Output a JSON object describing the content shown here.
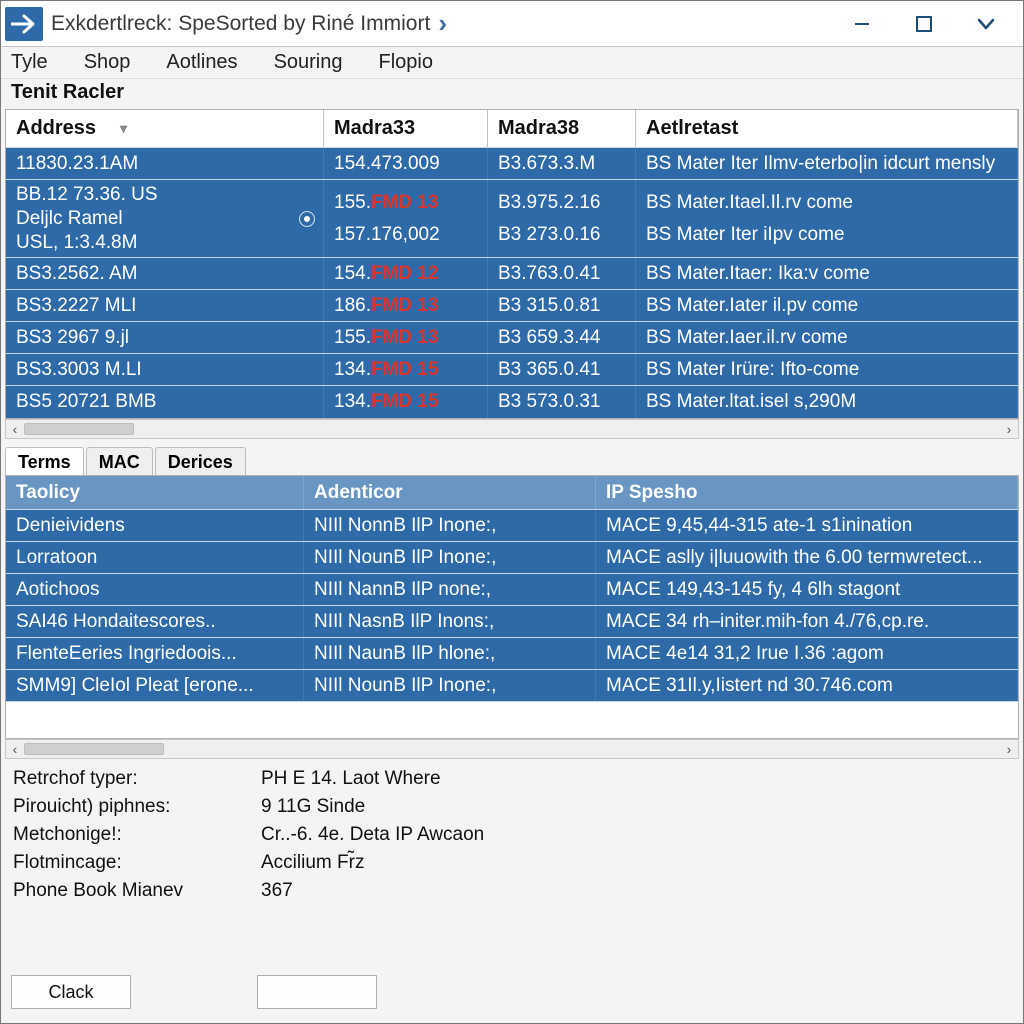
{
  "titlebar": {
    "title": "Exkdertlreck: SpeSorted by Riné Immiort",
    "caret_glyph": "›"
  },
  "menubar": [
    "Tyle",
    "Shop",
    "Aotlines",
    "Souring",
    "Flopio"
  ],
  "section_title": "Tenit Racler",
  "table1": {
    "headers": [
      "Address",
      "Madra33",
      "Madra38",
      "Aetlretast"
    ],
    "rows": [
      {
        "c1_lines": [
          "11830.23.1AM"
        ],
        "c2_parts": [
          "154.473.009",
          ""
        ],
        "c3": "B3.673.3.M",
        "c4": "BS Mater Iter Ilmv-eterbo|in idcurt mensly"
      },
      {
        "c1_lines": [
          "BB.12 73.36. US",
          "Deljlc Ramel",
          "USL, 1:3.4.8M"
        ],
        "c2_parts": [
          "155.",
          "FMD 13"
        ],
        "c2b_parts": [
          "157.176,002",
          ""
        ],
        "c3": "B3.975.2.16",
        "c3b": "B3 273.0.16",
        "c4": "BS Mater.Itael.Il.rv come",
        "c4b": "BS Mater Iter iIpv come",
        "has_radio": true,
        "tall": true
      },
      {
        "c1_lines": [
          "BS3.2562. AM"
        ],
        "c2_parts": [
          "154.",
          "FMD 12"
        ],
        "c3": "B3.763.0.41",
        "c4": "BS Mater.Itaer: Ika:v come"
      },
      {
        "c1_lines": [
          "BS3.2227 MLI"
        ],
        "c2_parts": [
          "186.",
          "FMD 13"
        ],
        "c3": "B3 315.0.81",
        "c4": "BS Mater.Iater il.pv come"
      },
      {
        "c1_lines": [
          "BS3 2967 9.jl"
        ],
        "c2_parts": [
          "155.",
          "FMD 13"
        ],
        "c3": "B3 659.3.44",
        "c4": "BS Mater.Iaer.il.rv come"
      },
      {
        "c1_lines": [
          "BS3.3003 M.LI"
        ],
        "c2_parts": [
          "134.",
          "FMD 15"
        ],
        "c3": "B3 365.0.41",
        "c4": "BS Mater Irüre: Ifto-come"
      },
      {
        "c1_lines": [
          "BS5 20721 BMB"
        ],
        "c2_parts": [
          "134.",
          "FMD 15"
        ],
        "c3": "B3 573.0.31",
        "c4": "BS Mater.ltat.isel s,290M"
      }
    ]
  },
  "tabs": [
    "Terms",
    "MAC",
    "Derices"
  ],
  "table2": {
    "headers": [
      "Taolicy",
      "Adenticor",
      "IP Spesho"
    ],
    "rows": [
      {
        "c1": "Denieividens",
        "c2": "NIIl NonnB IlP Inone:,",
        "c3": "MACE 9,45,44-315 ate-1 s1inination"
      },
      {
        "c1": "Lorratoon",
        "c2": "NIIl NounB IlP Inone:,",
        "c3": "MACE aslly i|luuowith the 6.00 termwretect..."
      },
      {
        "c1": "Aotichoos",
        "c2": "NIIl NannB IlP none:,",
        "c3": "MACE 149,43-145 fy, 4 6lh stagont"
      },
      {
        "c1": "SAI46 Hondaitescores..",
        "c2": "NIIl NasnB IlP Inons:,",
        "c3": "MACE 34 rh–initer.mih-fon 4./76,cp.re."
      },
      {
        "c1": "FlenteEeries Ingriedoois...",
        "c2": "NIIl NaunB IlP hlone:,",
        "c3": "MACE 4e14 31,2 Irue I.36 :agom"
      },
      {
        "c1": "SMM9] CleIol Pleat [erone...",
        "c2": "NIIl NounB IlP Inone:,",
        "c3": "MACE 31Il.y,Iistert nd 30.746.com"
      }
    ]
  },
  "details": [
    {
      "k": "Retrchof typer:",
      "v": "PH E 14. Laot Where"
    },
    {
      "k": "Pirouicht) piphnes:",
      "v": "9 11G Sinde"
    },
    {
      "k": "Metchonige!:",
      "v": "Cr..-6. 4e. Deta IP Awcaon"
    },
    {
      "k": "Flotmincage:",
      "v": "Accilium Fr̃z"
    },
    {
      "k": "Phone Book Mianev",
      "v": "367"
    }
  ],
  "buttons": {
    "primary": "Clack",
    "secondary": ""
  }
}
